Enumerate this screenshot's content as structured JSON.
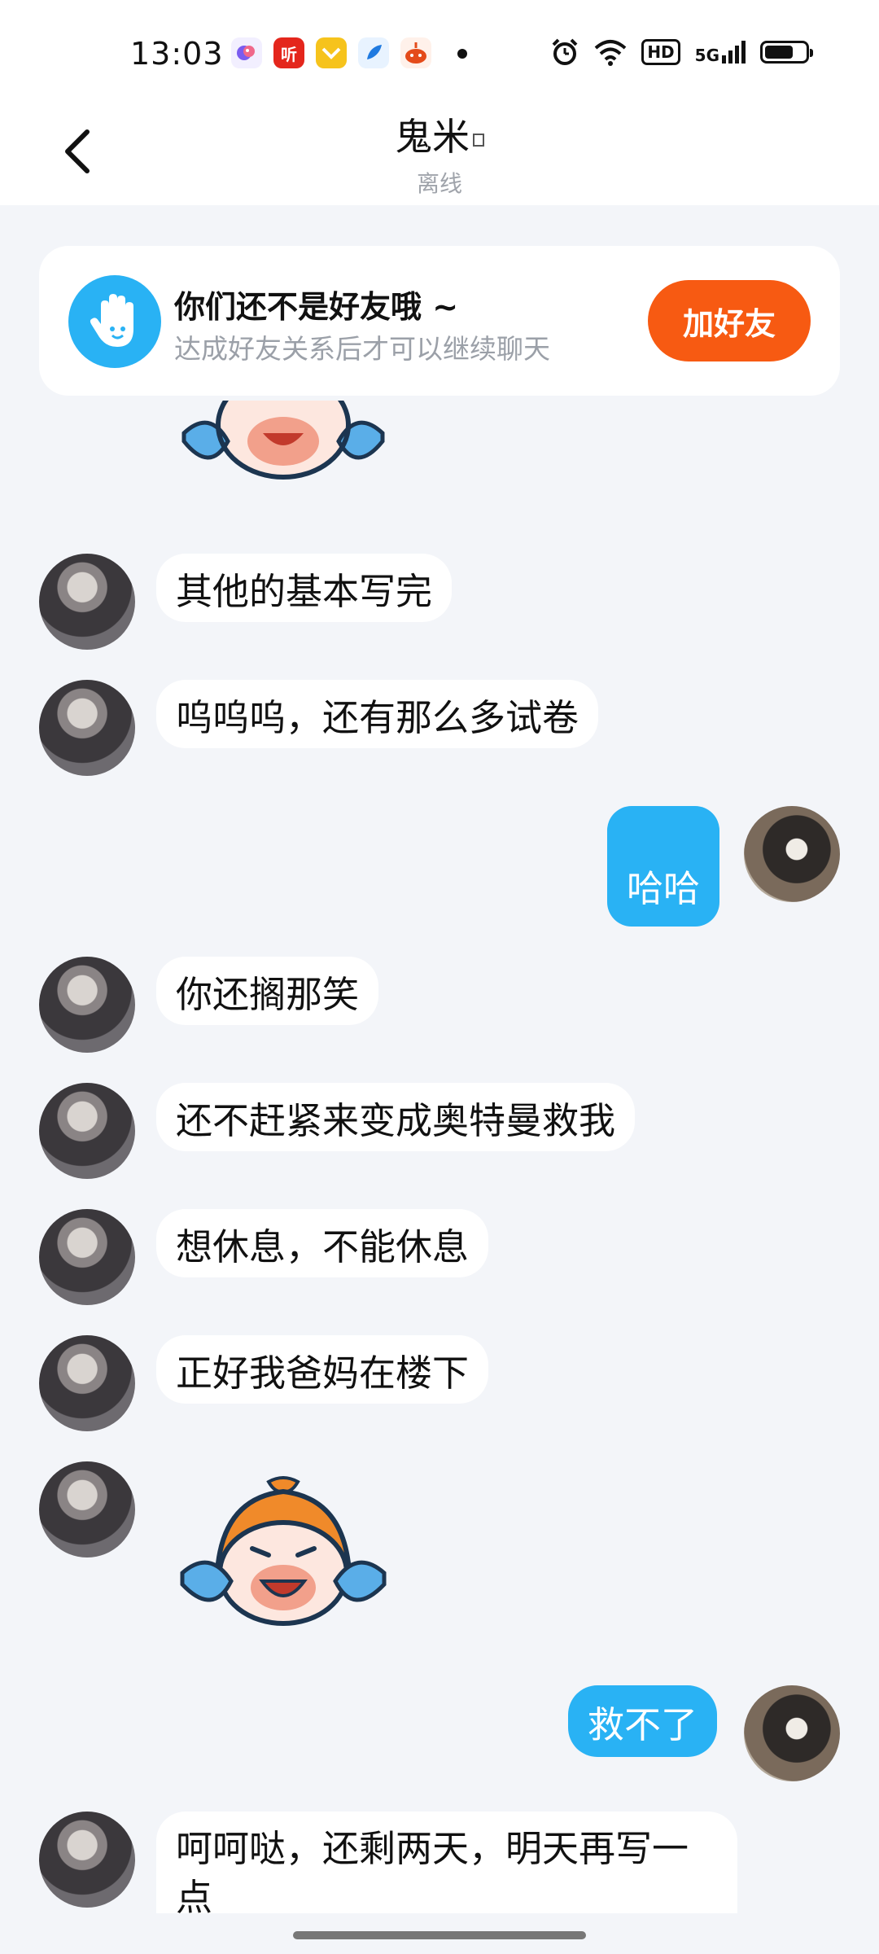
{
  "status_bar": {
    "time": "13:03",
    "app_icons": [
      "bird-app-icon",
      "ting-app-icon",
      "wallet-app-icon",
      "feather-app-icon",
      "radio-app-icon"
    ],
    "ting_label": "听",
    "hd_label": "HD",
    "network_label": "5G",
    "battery_percent": 70
  },
  "header": {
    "title": "鬼米",
    "status": "离线"
  },
  "friend_banner": {
    "title": "你们还不是好友哦 ~",
    "subtitle": "达成好友关系后才可以继续聊天",
    "button_label": "加好友"
  },
  "messages": [
    {
      "side": "left",
      "type": "sticker",
      "sticker": "crying-cartoon-sticker"
    },
    {
      "side": "left",
      "type": "text",
      "text": "其他的基本写完"
    },
    {
      "side": "left",
      "type": "text",
      "text": "呜呜呜，还有那么多试卷"
    },
    {
      "side": "right",
      "type": "text",
      "text": "哈哈"
    },
    {
      "side": "left",
      "type": "text",
      "text": "你还搁那笑"
    },
    {
      "side": "left",
      "type": "text",
      "text": "还不赶紧来变成奥特曼救我"
    },
    {
      "side": "left",
      "type": "text",
      "text": "想休息，不能休息"
    },
    {
      "side": "left",
      "type": "text",
      "text": "正好我爸妈在楼下"
    },
    {
      "side": "left",
      "type": "sticker",
      "sticker": "crying-cartoon-sticker"
    },
    {
      "side": "right",
      "type": "text",
      "text": "救不了"
    },
    {
      "side": "left",
      "type": "text",
      "text": "呵呵哒，还剩两天，明天再写一点"
    }
  ],
  "colors": {
    "accent_blue": "#29b2f4",
    "add_button_orange": "#f75a12",
    "background": "#f3f5f9"
  }
}
